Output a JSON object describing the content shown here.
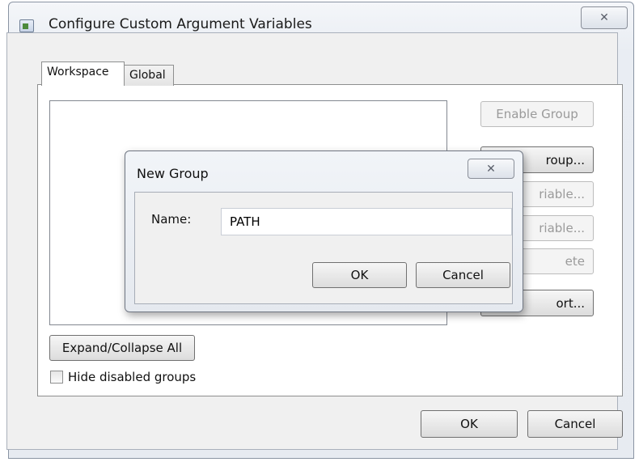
{
  "window": {
    "title": "Configure Custom Argument Variables",
    "close_glyph": "✕"
  },
  "tabs": [
    {
      "label": "Workspace",
      "selected": true
    },
    {
      "label": "Global",
      "selected": false
    }
  ],
  "buttons": {
    "enable_group": "Enable Group",
    "add_group": "roup...",
    "add_variable": "riable...",
    "edit_variable": "riable...",
    "delete": "ete",
    "import": "ort...",
    "expand_collapse": "Expand/Collapse All",
    "ok": "OK",
    "cancel": "Cancel"
  },
  "options": {
    "hide_disabled_groups": {
      "label": "Hide disabled groups",
      "checked": false
    }
  },
  "dialog": {
    "title": "New Group",
    "close_glyph": "✕",
    "name_label": "Name:",
    "name_value": "PATH",
    "ok": "OK",
    "cancel": "Cancel"
  }
}
